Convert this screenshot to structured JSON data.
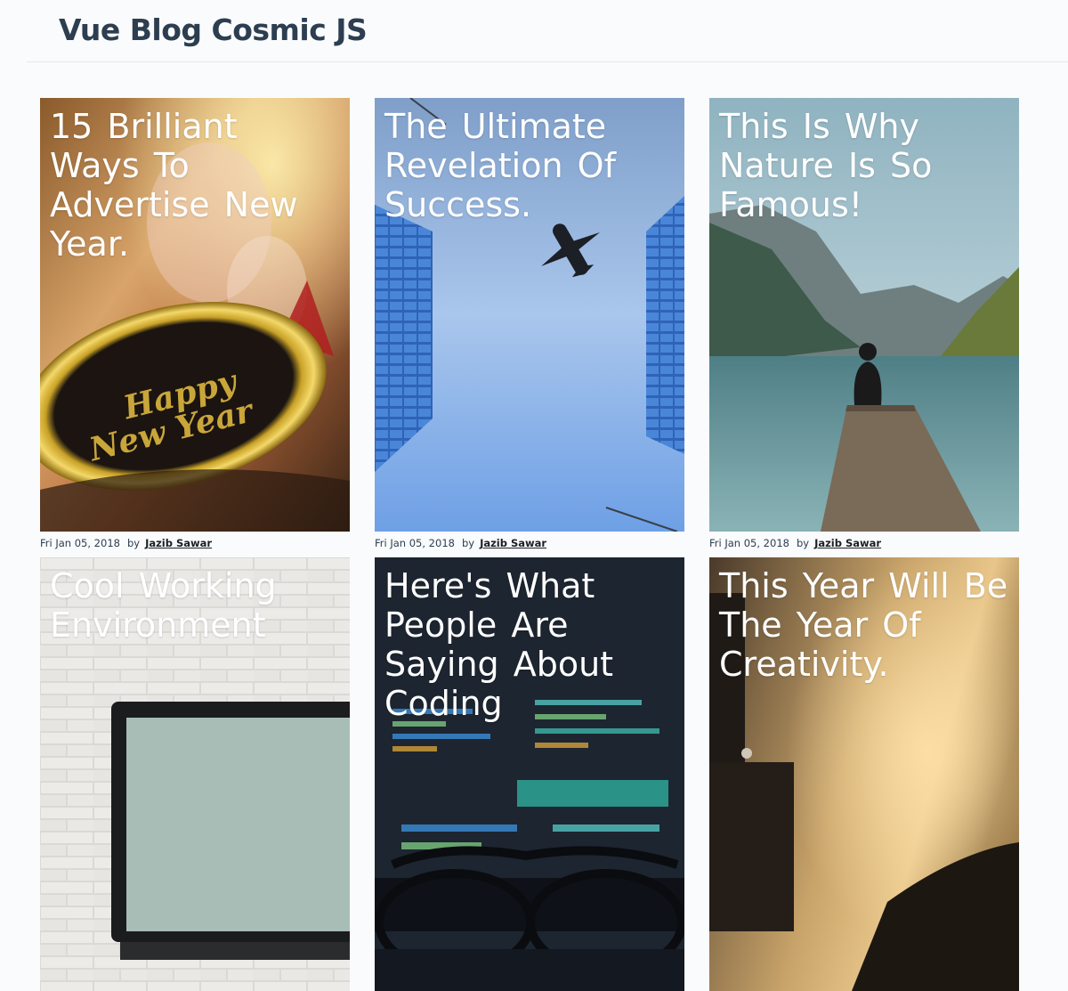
{
  "header": {
    "title": "Vue Blog Cosmic JS"
  },
  "posts": [
    {
      "title": "15 Brilliant Ways To Advertise New Year.",
      "date": "Fri Jan 05, 2018",
      "by": "by",
      "author": "Jazib Sawar",
      "image_icon": "new-year-badge-photo"
    },
    {
      "title": "The Ultimate Revelation Of Success.",
      "date": "Fri Jan 05, 2018",
      "by": "by",
      "author": "Jazib Sawar",
      "image_icon": "airplane-between-buildings-photo"
    },
    {
      "title": "This Is Why Nature Is So Famous!",
      "date": "Fri Jan 05, 2018",
      "by": "by",
      "author": "Jazib Sawar",
      "image_icon": "mountain-lake-pier-photo"
    },
    {
      "title": "Cool Working Environment",
      "image_icon": "laptop-brick-wall-photo"
    },
    {
      "title": "Here's What People Are Saying About Coding",
      "image_icon": "code-screen-glasses-photo"
    },
    {
      "title": "This Year Will Be The Year Of Creativity.",
      "image_icon": "cardboard-robot-photo"
    }
  ],
  "colors": {
    "brand": "#2c3e50",
    "title_text": "#ffffff",
    "meta_text": "#2c3e50"
  }
}
